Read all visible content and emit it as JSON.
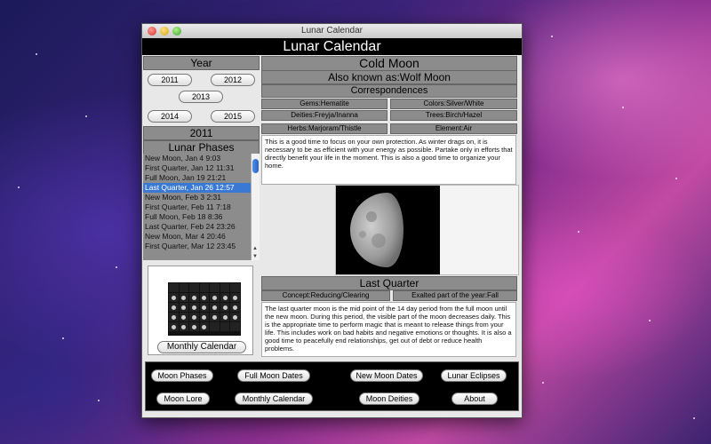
{
  "window": {
    "title": "Lunar Calendar",
    "banner": "Lunar Calendar"
  },
  "year_panel": {
    "header": "Year",
    "buttons": [
      "2011",
      "2012",
      "2013",
      "2014",
      "2015"
    ],
    "selected_year": "2011"
  },
  "phases": {
    "header": "Lunar Phases",
    "items": [
      "New Moon, Jan  4  9:03",
      "First Quarter, Jan 12 11:31",
      "Full Moon, Jan 19 21:21",
      "Last Quarter, Jan 26 12:57",
      "New Moon, Feb  3  2:31",
      "First Quarter, Feb 11  7:18",
      "Full Moon, Feb 18  8:36",
      "Last Quarter, Feb 24 23:26",
      "New Moon, Mar  4 20:46",
      "First Quarter, Mar 12 23:45"
    ],
    "selected_index": 3
  },
  "monthly_calendar_label": "Monthly Calendar",
  "moon": {
    "name": "Cold Moon",
    "aka": "Also known as:Wolf Moon",
    "correspondences_header": "Correspondences",
    "gems": "Gems:Hematite",
    "colors": "Colors:Silver/White",
    "deities": "Deities:Freyja/Inanna",
    "trees": "Trees:Birch/Hazel",
    "herbs": "Herbs:Marjoram/Thistle",
    "element": "Element:Air",
    "description": "This is a good time to focus on your own protection. As winter drags on, it is necessary to be as efficient with your energy as possible. Partake only in efforts that directly benefit your life in the moment. This is also a good time to organize your home."
  },
  "phase_detail": {
    "title": "Last Quarter",
    "concept": "Concept:Reducing/Clearing",
    "exalted": "Exalted part of the year:Fall",
    "description": "The last quarter moon is the mid point of the 14 day period from the full moon until the new moon. During this period, the visible part of the moon decreases daily. This is the appropriate time to perform magic that is meant to release things from your life. This includes work on bad habits and  negative emotions or thoughts. It is also a good time to  peacefully end relationships, get out of debt or reduce health problems."
  },
  "bottom_buttons": {
    "row1": [
      "Moon Phases",
      "Full Moon Dates",
      "New Moon Dates",
      "Lunar Eclipses"
    ],
    "row2": [
      "Moon Lore",
      "Monthly Calendar",
      "Moon Deities",
      "About"
    ]
  }
}
